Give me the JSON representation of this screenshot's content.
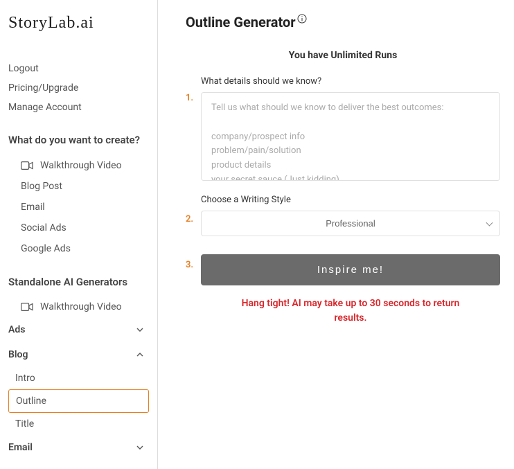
{
  "logo": "StoryLab.ai",
  "top_links": {
    "logout": "Logout",
    "pricing": "Pricing/Upgrade",
    "manage": "Manage Account"
  },
  "create_section": {
    "title": "What do you want to create?",
    "walkthrough": "Walkthrough Video",
    "blog_post": "Blog Post",
    "email": "Email",
    "social_ads": "Social Ads",
    "google_ads": "Google Ads"
  },
  "standalone_section": {
    "title": "Standalone AI Generators",
    "walkthrough": "Walkthrough Video"
  },
  "groups": {
    "ads": "Ads",
    "blog": "Blog",
    "blog_items": {
      "intro": "Intro",
      "outline": "Outline",
      "title_item": "Title"
    },
    "email": "Email"
  },
  "main": {
    "title": "Outline Generator",
    "subtitle": "You have Unlimited Runs",
    "step1_label": "What details should we know?",
    "step1_placeholder": "Tell us what should we know to deliver the best outcomes:\n\ncompany/prospect info\nproblem/pain/solution\nproduct details\nyour secret sauce (Just kidding)",
    "step2_label": "Choose a Writing Style",
    "step2_value": "Professional",
    "button": "Inspire me!",
    "wait_msg": "Hang tight! AI may take up to 30 seconds to return results.",
    "num1": "1.",
    "num2": "2.",
    "num3": "3."
  }
}
